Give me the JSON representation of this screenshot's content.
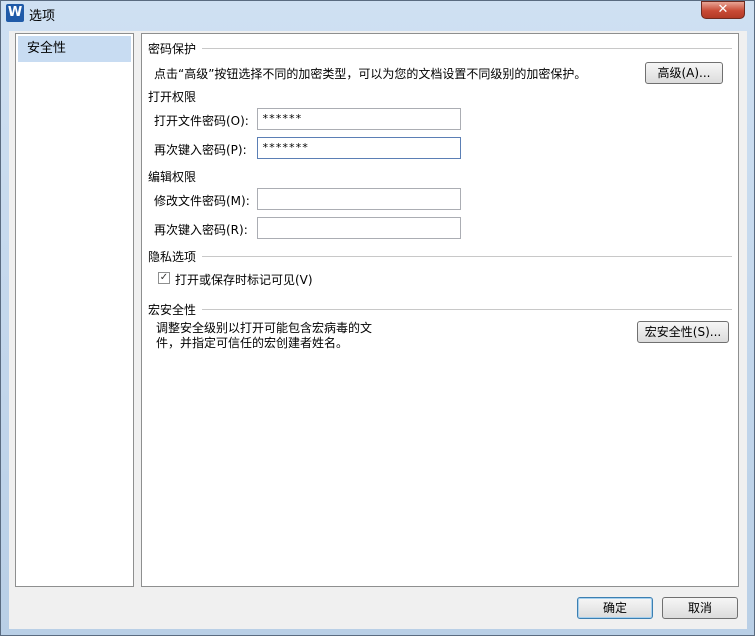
{
  "window": {
    "title": "选项",
    "app_icon": "W",
    "close_glyph": "✕"
  },
  "nav": {
    "items": [
      {
        "label": "安全性",
        "selected": true
      }
    ]
  },
  "password_protection": {
    "section_title": "密码保护",
    "description": "点击“高级”按钮选择不同的加密类型，可以为您的文档设置不同级别的加密保护。",
    "advanced_button": "高级(A)...",
    "open_permission_title": "打开权限",
    "open_password_label": "打开文件密码(O):",
    "open_password_value": "******",
    "reenter_open_label": "再次键入密码(P):",
    "reenter_open_value": "*******",
    "edit_permission_title": "编辑权限",
    "modify_password_label": "修改文件密码(M):",
    "modify_password_value": "",
    "reenter_modify_label": "再次键入密码(R):",
    "reenter_modify_value": ""
  },
  "privacy": {
    "section_title": "隐私选项",
    "checkbox_label": "打开或保存时标记可见(V)",
    "checked": true
  },
  "macro": {
    "section_title": "宏安全性",
    "description_line1": "调整安全级别以打开可能包含宏病毒的文",
    "description_line2": "件，并指定可信任的宏创建者姓名。",
    "button": "宏安全性(S)..."
  },
  "footer": {
    "ok": "确定",
    "cancel": "取消"
  }
}
